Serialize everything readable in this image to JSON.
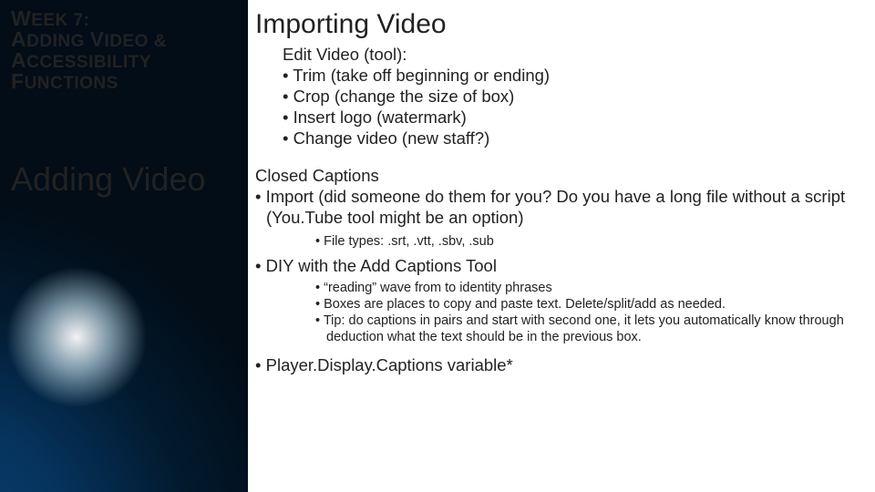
{
  "left": {
    "heading_html": "Week 7:\nAdding Video &\nAccessibility\nFunctions",
    "week_line1_big": "W",
    "week_line1_rest": "EEK 7:",
    "week_line2_big": "A",
    "week_line2_rest": "DDING ",
    "week_line2_big2": "V",
    "week_line2_rest2": "IDEO &",
    "week_line3_big": "A",
    "week_line3_rest": "CCESSIBILITY",
    "week_line4_big": "F",
    "week_line4_rest": "UNCTIONS",
    "side_title": "Adding Video"
  },
  "right": {
    "title": "Importing Video",
    "edit_heading": "Edit Video (tool):",
    "edit_items": [
      "Trim (take off beginning or ending)",
      "Crop (change the size of box)",
      "Insert logo (watermark)",
      "Change video (new staff?)"
    ],
    "cc_heading": "Closed Captions",
    "cc_import": "Import (did someone do them for you? Do you have a long file without a script (You.Tube tool might be an option)",
    "cc_filetypes": "File types: .srt, .vtt, .sbv, .sub",
    "cc_diy": "DIY with the Add Captions Tool",
    "cc_diy_items": [
      "“reading” wave from to identity phrases",
      "Boxes are places to copy and paste text. Delete/split/add as needed.",
      "Tip: do captions in pairs and start with second one, it lets you automatically know through deduction what the text should be in the previous box."
    ],
    "cc_player": "Player.Display.Captions variable*"
  }
}
